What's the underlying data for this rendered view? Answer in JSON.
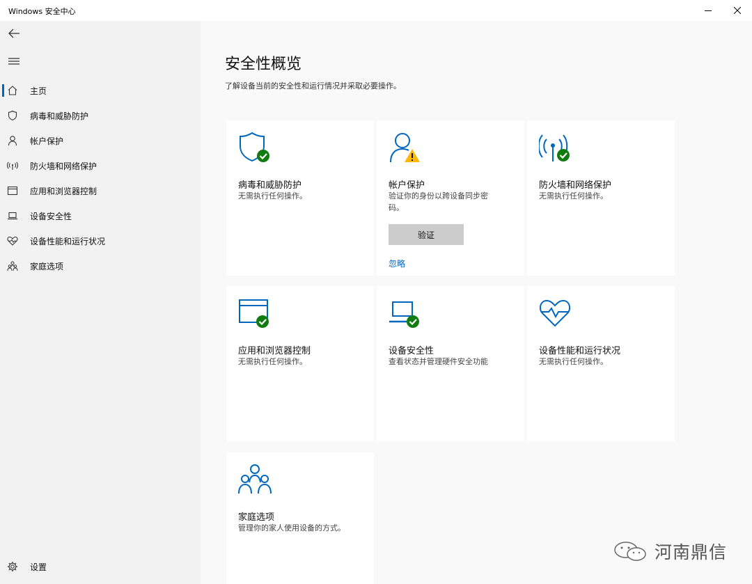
{
  "window": {
    "title": "Windows 安全中心"
  },
  "sidebar": {
    "items": [
      {
        "label": "主页",
        "icon": "home-icon",
        "active": true
      },
      {
        "label": "病毒和威胁防护",
        "icon": "shield-icon"
      },
      {
        "label": "帐户保护",
        "icon": "person-icon"
      },
      {
        "label": "防火墙和网络保护",
        "icon": "wifi-icon"
      },
      {
        "label": "应用和浏览器控制",
        "icon": "app-window-icon"
      },
      {
        "label": "设备安全性",
        "icon": "laptop-icon"
      },
      {
        "label": "设备性能和运行状况",
        "icon": "heart-icon"
      },
      {
        "label": "家庭选项",
        "icon": "family-icon"
      }
    ],
    "settings_label": "设置"
  },
  "main": {
    "title": "安全性概览",
    "subtitle": "了解设备当前的安全性和运行情况并采取必要操作。",
    "tiles": [
      {
        "name": "病毒和威胁防护",
        "desc": "无需执行任何操作。",
        "status": "ok"
      },
      {
        "name": "帐户保护",
        "desc": "验证你的身份以跨设备同步密码。",
        "status": "warning",
        "button_label": "验证",
        "link_label": "忽略"
      },
      {
        "name": "防火墙和网络保护",
        "desc": "无需执行任何操作。",
        "status": "ok"
      },
      {
        "name": "应用和浏览器控制",
        "desc": "无需执行任何操作。",
        "status": "ok"
      },
      {
        "name": "设备安全性",
        "desc": "查看状态并管理硬件安全功能",
        "status": "ok"
      },
      {
        "name": "设备性能和运行状况",
        "desc": "无需执行任何操作。",
        "status": "none"
      },
      {
        "name": "家庭选项",
        "desc": "管理你的家人使用设备的方式。",
        "status": "none"
      }
    ]
  },
  "watermark": {
    "text": "河南鼎信"
  },
  "colors": {
    "accent": "#0067c0",
    "ok": "#107c10",
    "warning": "#ffb900",
    "sidebar_bg": "#f2f2f2"
  }
}
